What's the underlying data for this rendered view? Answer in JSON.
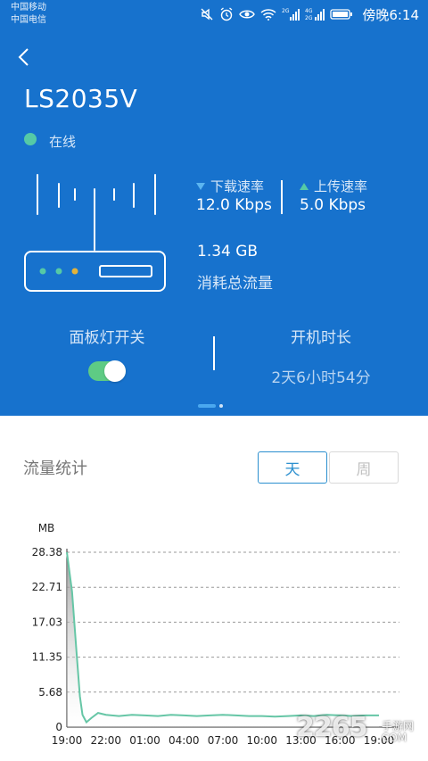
{
  "status_bar": {
    "carrier1": "中国移动",
    "carrier2": "中国电信",
    "time": "傍晚6:14",
    "icons": [
      "mute-icon",
      "alarm-icon",
      "eye-icon",
      "wifi-icon",
      "signal-2g-icon",
      "signal-4g-icon",
      "battery-icon"
    ]
  },
  "device": {
    "name": "LS2035V",
    "status": "在线",
    "status_color": "#55c9a6"
  },
  "speed": {
    "download_label": "下载速率",
    "download_value": "12.0 Kbps",
    "upload_label": "上传速率",
    "upload_value": "5.0 Kbps"
  },
  "traffic": {
    "total_value": "1.34 GB",
    "total_label": "消耗总流量"
  },
  "panel_light": {
    "label": "面板灯开关",
    "on": true
  },
  "uptime": {
    "label": "开机时长",
    "value": "2天6小时54分"
  },
  "stats": {
    "title": "流量统计",
    "tabs": [
      {
        "label": "天",
        "active": true
      },
      {
        "label": "周",
        "active": false
      }
    ]
  },
  "watermark": {
    "big": "2265",
    "small1": "手游网",
    "small2": "COM"
  },
  "colors": {
    "header_bg": "#1772cd",
    "toggle_on": "#5ecb84",
    "line": "#66c6a6",
    "tab_active": "#2b8fcf"
  },
  "chart_data": {
    "type": "area",
    "ylabel": "MB",
    "yticks": [
      "0",
      "5.68",
      "11.35",
      "17.03",
      "22.71",
      "28.38"
    ],
    "ylim": [
      0,
      28.38
    ],
    "xticks": [
      "19:00",
      "22:00",
      "01:00",
      "04:00",
      "07:00",
      "10:00",
      "13:00",
      "16:00",
      "19:00"
    ],
    "grid": true,
    "x": [
      0,
      0.4,
      0.75,
      1,
      1.2,
      1.5,
      1.9,
      2.4,
      3,
      4,
      5,
      6,
      7,
      8,
      9,
      10,
      11,
      12,
      13,
      14,
      15,
      16,
      17,
      18,
      19,
      20,
      21,
      22,
      23,
      24
    ],
    "values": [
      28.38,
      22,
      12,
      5,
      2,
      0.8,
      1.5,
      2.3,
      2.0,
      1.8,
      2.0,
      1.9,
      1.8,
      2.0,
      1.9,
      1.8,
      1.9,
      2.0,
      1.9,
      1.8,
      1.8,
      1.7,
      1.8,
      1.9,
      1.8,
      2.0,
      1.9,
      1.8,
      1.9,
      1.9
    ]
  }
}
